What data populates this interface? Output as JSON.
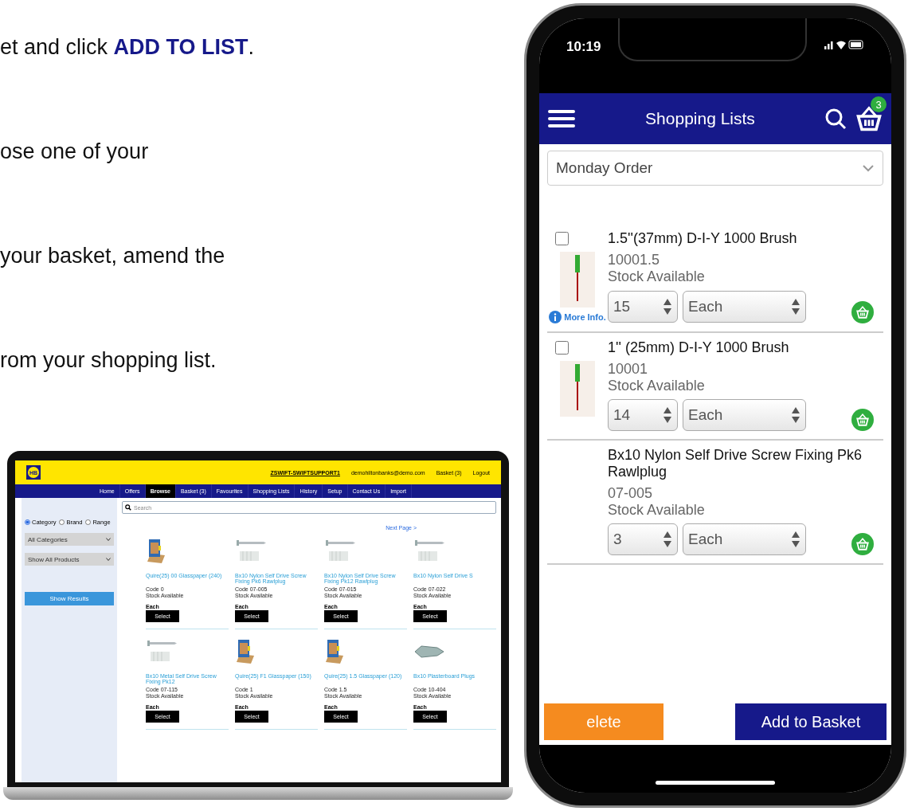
{
  "instructions": [
    "et and click **ADD TO LIST**.",
    "ose one of your",
    "your basket, amend the",
    "rom your shopping list."
  ],
  "laptop": {
    "logo": "HB",
    "account": "ZSWIFT-SWIFTSUPPORT1",
    "email": "demohiltonbanks@demo.com",
    "basket": "Basket (3)",
    "logout": "Logout",
    "nav": [
      {
        "label": "Home",
        "selected": false
      },
      {
        "label": "Offers",
        "selected": false
      },
      {
        "label": "Browse",
        "selected": true
      },
      {
        "label": "Basket (3)",
        "selected": false
      },
      {
        "label": "Favourites",
        "selected": false
      },
      {
        "label": "Shopping Lists",
        "selected": false
      },
      {
        "label": "History",
        "selected": false
      },
      {
        "label": "Setup",
        "selected": false
      },
      {
        "label": "Contact Us",
        "selected": false
      },
      {
        "label": "Import",
        "selected": false
      }
    ],
    "search": {
      "placeholder": "Search"
    },
    "filters": [
      {
        "label": "Category",
        "selected": true
      },
      {
        "label": "Brand",
        "selected": false
      },
      {
        "label": "Range",
        "selected": false
      }
    ],
    "selects": [
      "All Categories",
      "Show All Products"
    ],
    "show_results": "Show Results",
    "next_page": "Next Page >",
    "products": [
      {
        "kind": "glasspaper",
        "name": "Quire(25) 00 Glasspaper (240)",
        "code": "Code 0",
        "stock": "Stock Available",
        "unit": "Each",
        "button": "Select"
      },
      {
        "kind": "screw",
        "name": "Bx10 Nylon Self Drive Screw Fixing Pk6 Rawlplug",
        "code": "Code 07-005",
        "stock": "Stock Available",
        "unit": "Each",
        "button": "Select"
      },
      {
        "kind": "screw",
        "name": "Bx10 Nylon Self Drive Screw Fixing Pk12 Rawlplug",
        "code": "Code 07-015",
        "stock": "Stock Available",
        "unit": "Each",
        "button": "Select"
      },
      {
        "kind": "screw",
        "name": "Bx10 Nylon Self Drive S",
        "code": "Code 07-022",
        "stock": "Stock Available",
        "unit": "Each",
        "button": "Select"
      },
      {
        "kind": "screw",
        "name": "Bx10 Metal Self Drive Screw Fixing Pk12",
        "code": "Code 07-115",
        "stock": "Stock Available",
        "unit": "Each",
        "button": "Select"
      },
      {
        "kind": "glasspaper",
        "name": "Quire(25) F1 Glasspaper (150)",
        "code": "Code 1",
        "stock": "Stock Available",
        "unit": "Each",
        "button": "Select"
      },
      {
        "kind": "glasspaper",
        "name": "Quire(25) 1.5 Glasspaper (120)",
        "code": "Code 1.5",
        "stock": "Stock Available",
        "unit": "Each",
        "button": "Select"
      },
      {
        "kind": "plug",
        "name": "Bx10 Plasterboard Plugs",
        "code": "Code 10-404",
        "stock": "Stock Available",
        "unit": "Each",
        "button": "Select"
      }
    ]
  },
  "phone": {
    "time": "10:19",
    "title": "Shopping Lists",
    "basket_count": "3",
    "list_select": "Monday Order",
    "items": [
      {
        "checked": false,
        "kind": "brush",
        "name": "1.5''(37mm) D-I-Y 1000 Brush",
        "code": "10001.5",
        "stock": "Stock Available",
        "quantity": "15",
        "unit": "Each",
        "more_info": "More Info."
      },
      {
        "checked": false,
        "kind": "brush",
        "name": "1'' (25mm) D-I-Y 1000 Brush",
        "code": "10001",
        "stock": "Stock Available",
        "quantity": "14",
        "unit": "Each"
      },
      {
        "name": "Bx10 Nylon Self Drive Screw Fixing Pk6 Rawlplug",
        "code": "07-005",
        "stock": "Stock Available",
        "quantity": "3",
        "unit": "Each"
      }
    ],
    "delete": "elete",
    "add_to_basket": "Add to Basket"
  }
}
